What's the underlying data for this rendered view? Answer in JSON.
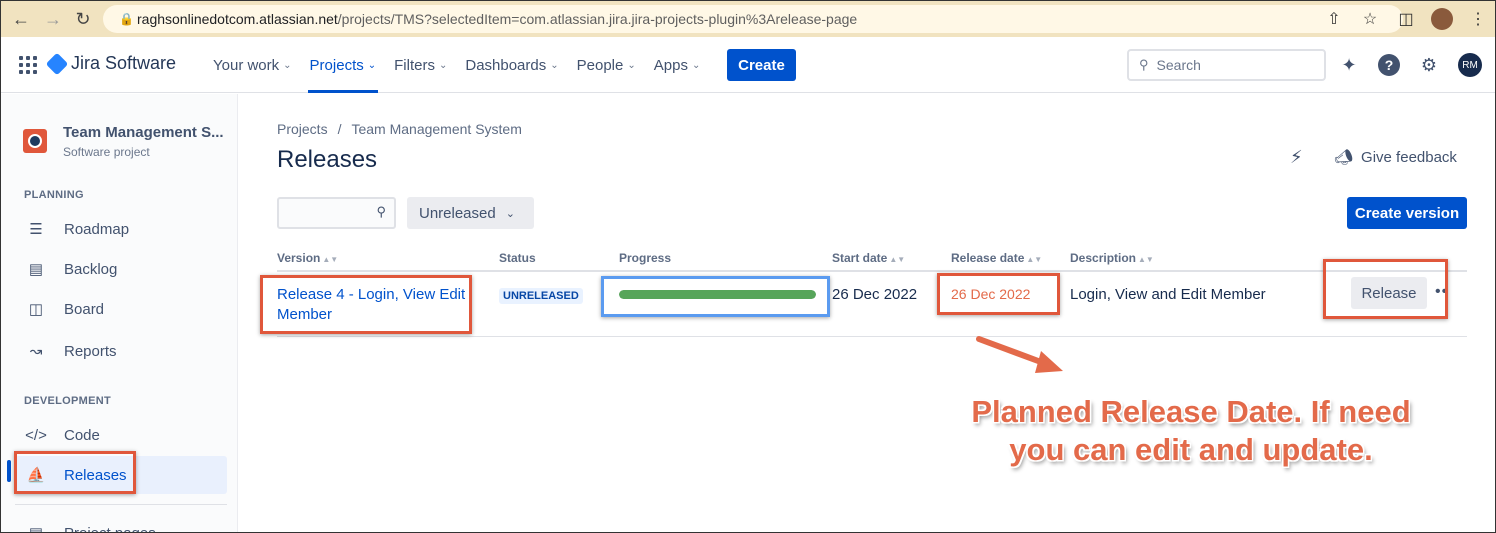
{
  "browser": {
    "url_host": "raghsonlinedotcom.atlassian.net",
    "url_path": "/projects/TMS?selectedItem=com.atlassian.jira.jira-projects-plugin%3Arelease-page"
  },
  "topnav": {
    "product_name": "Jira Software",
    "menu": [
      {
        "label": "Your work",
        "active": false
      },
      {
        "label": "Projects",
        "active": true
      },
      {
        "label": "Filters",
        "active": false
      },
      {
        "label": "Dashboards",
        "active": false
      },
      {
        "label": "People",
        "active": false
      },
      {
        "label": "Apps",
        "active": false
      }
    ],
    "create_label": "Create",
    "search_placeholder": "Search",
    "user_initials": "RM"
  },
  "sidebar": {
    "project_name": "Team Management S...",
    "project_type": "Software project",
    "planning_label": "PLANNING",
    "planning_items": [
      {
        "label": "Roadmap",
        "icon": "roadmap-icon"
      },
      {
        "label": "Backlog",
        "icon": "backlog-icon"
      },
      {
        "label": "Board",
        "icon": "board-icon"
      },
      {
        "label": "Reports",
        "icon": "reports-icon"
      }
    ],
    "development_label": "DEVELOPMENT",
    "development_items": [
      {
        "label": "Code",
        "icon": "code-icon",
        "active": false
      },
      {
        "label": "Releases",
        "icon": "ship-icon",
        "active": true
      }
    ],
    "cut_item": "Project pages"
  },
  "main": {
    "breadcrumb": [
      "Projects",
      "Team Management System"
    ],
    "title": "Releases",
    "feedback_label": "Give feedback",
    "status_filter": "Unreleased",
    "create_version_label": "Create version",
    "columns": [
      "Version",
      "Status",
      "Progress",
      "Start date",
      "Release date",
      "Description"
    ],
    "rows": [
      {
        "version": "Release 4 - Login, View Edit Member",
        "status": "UNRELEASED",
        "progress": 1.0,
        "start_date": "26 Dec 2022",
        "release_date": "26 Dec 2022",
        "description": "Login, View and Edit Member",
        "action": "Release"
      }
    ]
  },
  "annotation": {
    "line1": "Planned Release Date. If need",
    "line2": "you can edit and update."
  },
  "colors": {
    "accent": "#0052cc",
    "highlight": "#e0573b",
    "progress": "#57a55a"
  }
}
